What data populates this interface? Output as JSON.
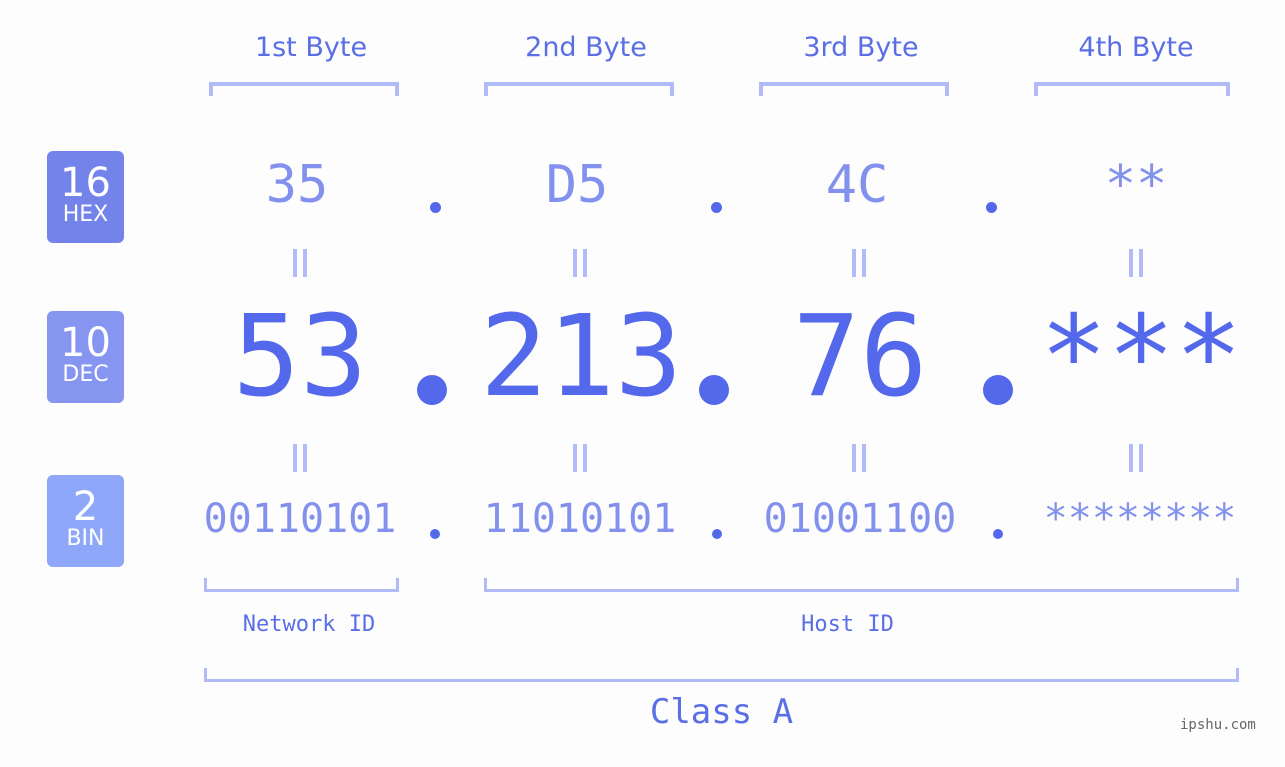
{
  "colors": {
    "hex_badge": "#7383ea",
    "dec_badge": "#8595f0",
    "bin_badge": "#8ea7f8",
    "primary_text": "#5468eb",
    "secondary_text": "#8391ee",
    "bracket": "#b1bbf7",
    "background": "#fcfdfc"
  },
  "headers": [
    "1st Byte",
    "2nd Byte",
    "3rd Byte",
    "4th Byte"
  ],
  "badges": {
    "hex": {
      "number": "16",
      "label": "HEX"
    },
    "dec": {
      "number": "10",
      "label": "DEC"
    },
    "bin": {
      "number": "2",
      "label": "BIN"
    }
  },
  "hex": [
    "35",
    "D5",
    "4C",
    "**"
  ],
  "dec": [
    "53",
    "213",
    "76",
    "***"
  ],
  "bin": [
    "00110101",
    "11010101",
    "01001100",
    "********"
  ],
  "separator": ".",
  "equals": "=",
  "network_id_label": "Network ID",
  "host_id_label": "Host ID",
  "class_label": "Class A",
  "watermark": "ipshu.com"
}
